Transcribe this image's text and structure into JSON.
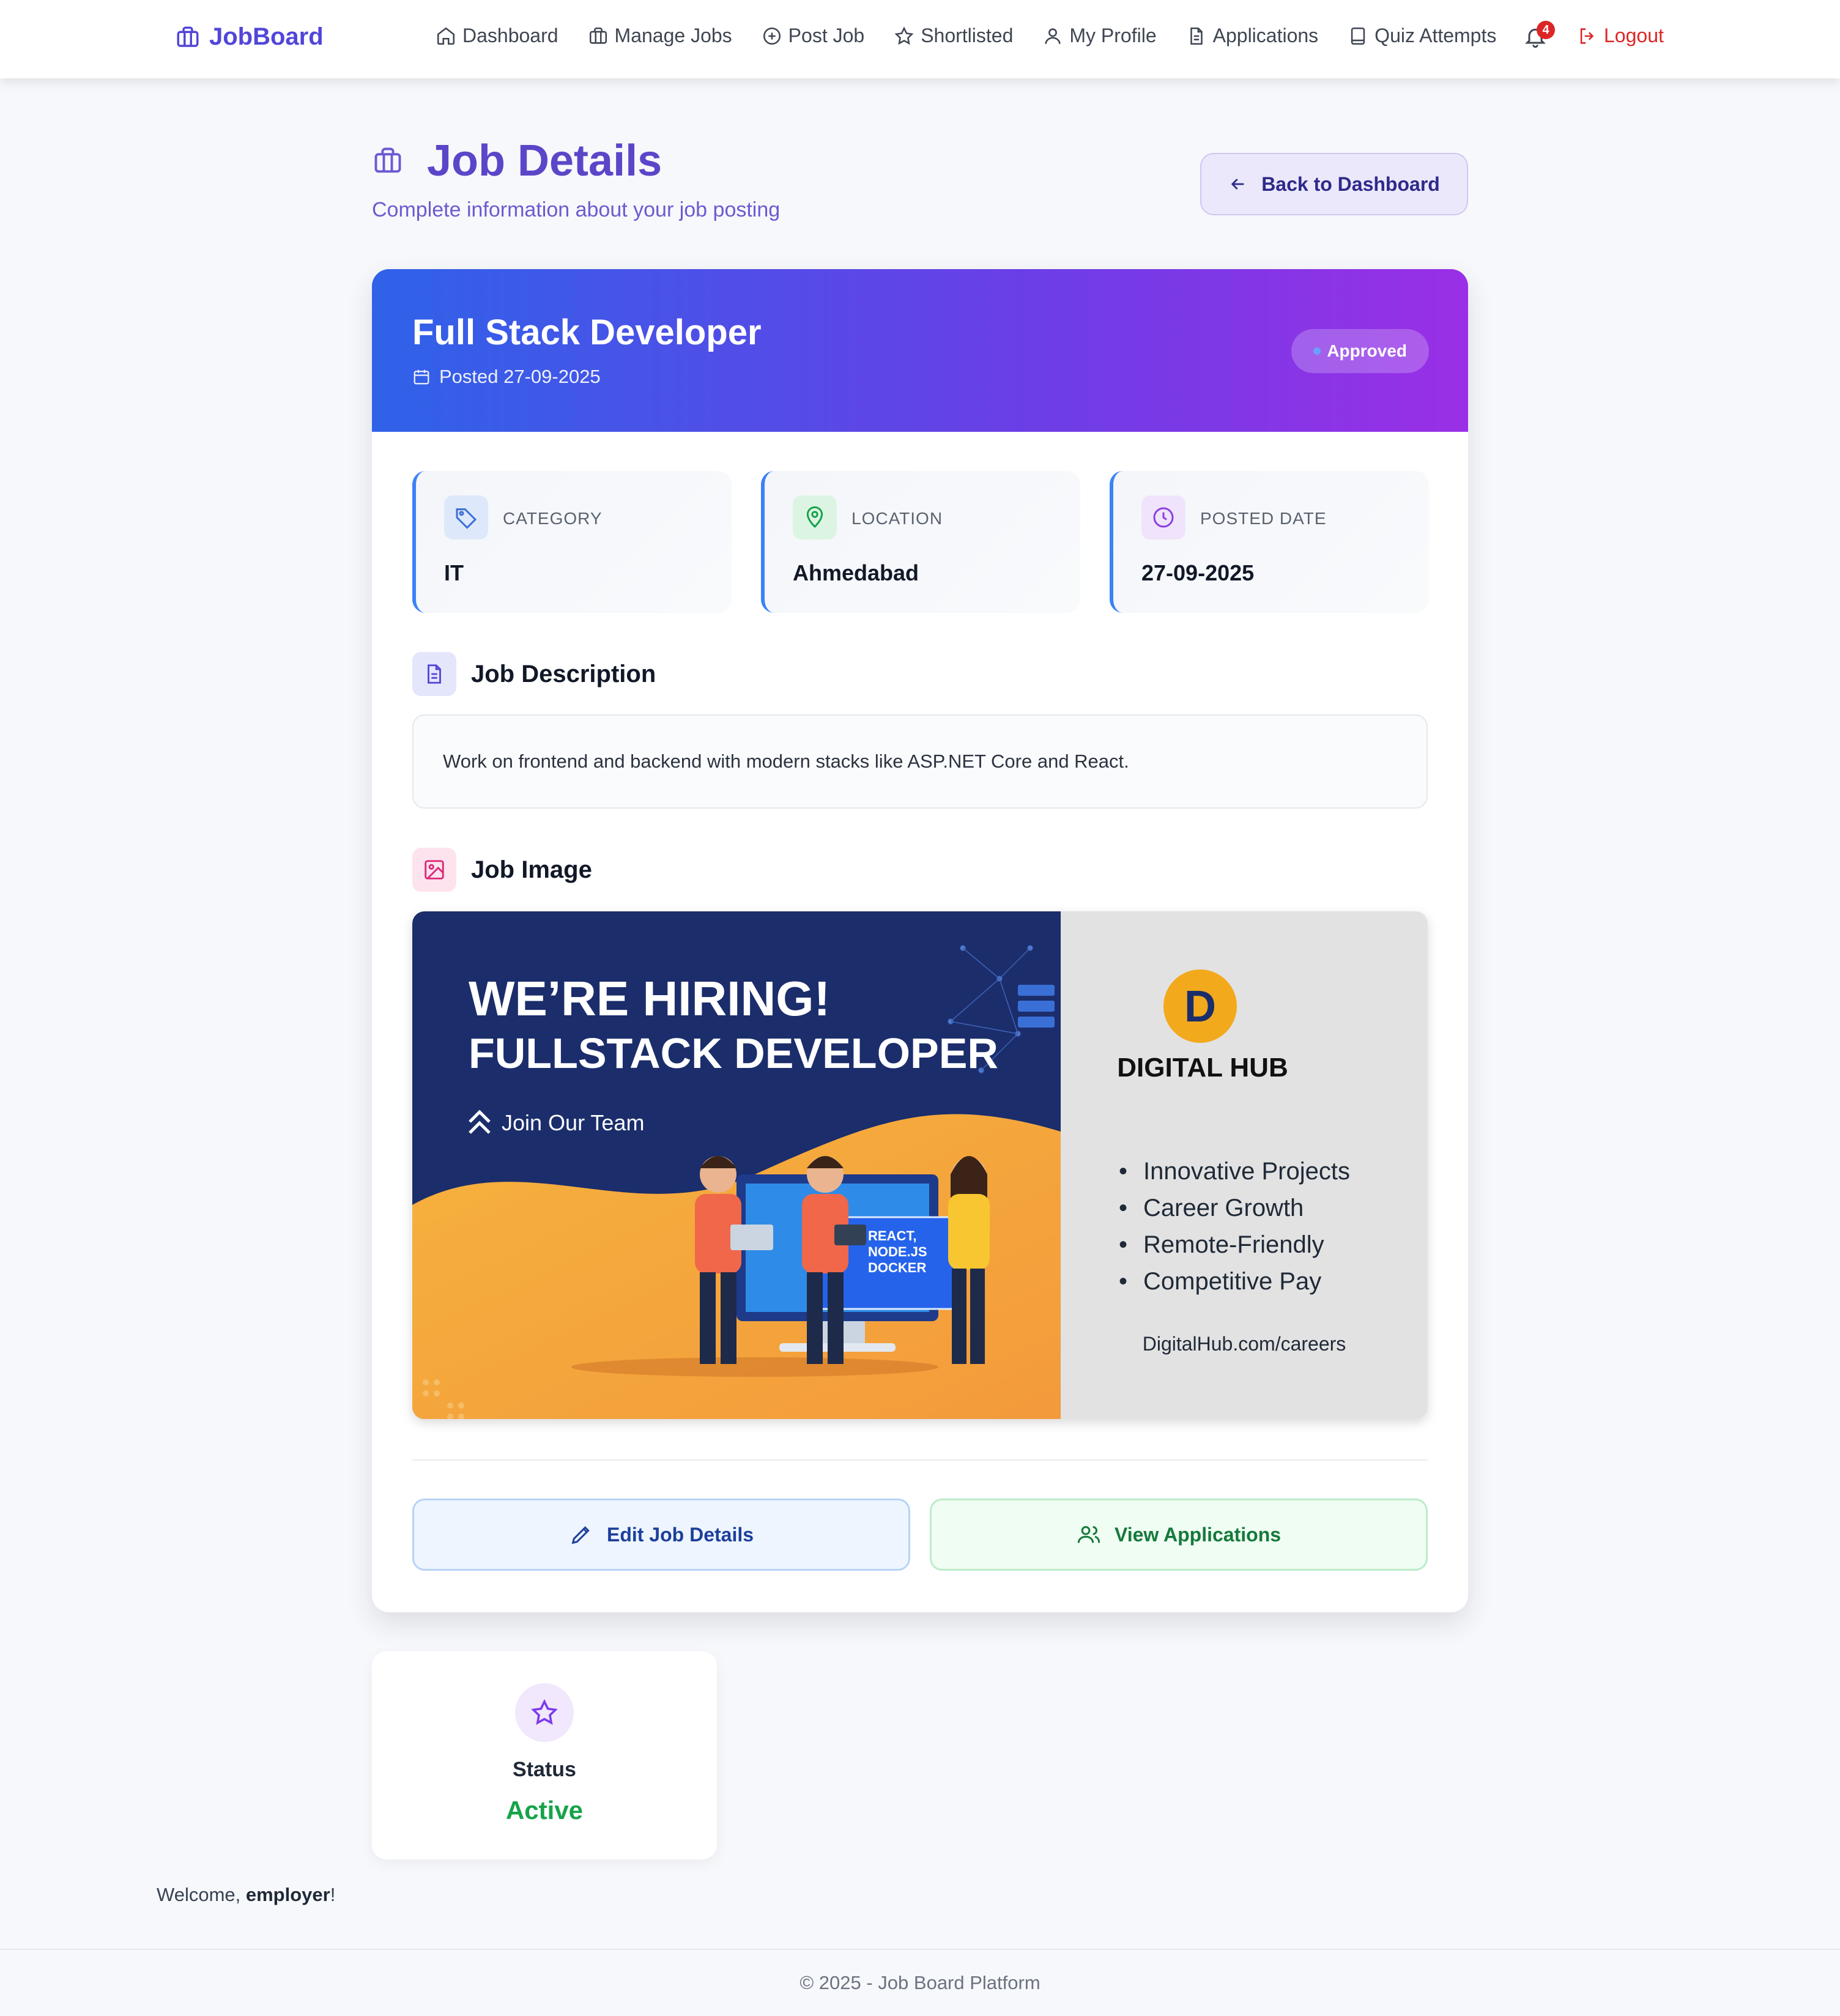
{
  "brand": {
    "name": "JobBoard"
  },
  "nav": {
    "items": [
      {
        "label": "Dashboard",
        "icon": "home-icon"
      },
      {
        "label": "Manage Jobs",
        "icon": "briefcase-icon"
      },
      {
        "label": "Post Job",
        "icon": "plus-circle-icon"
      },
      {
        "label": "Shortlisted",
        "icon": "star-icon"
      },
      {
        "label": "My Profile",
        "icon": "user-icon"
      },
      {
        "label": "Applications",
        "icon": "document-icon"
      },
      {
        "label": "Quiz Attempts",
        "icon": "book-icon"
      }
    ],
    "notifications_count": "4",
    "logout_label": "Logout"
  },
  "page": {
    "title": "Job Details",
    "subtitle": "Complete information about your job posting",
    "back_label": "Back to Dashboard"
  },
  "job": {
    "title": "Full Stack Developer",
    "posted_text": "Posted 27-09-2025",
    "status_badge": "Approved",
    "info": [
      {
        "label": "CATEGORY",
        "value": "IT",
        "icon": "tag-icon"
      },
      {
        "label": "LOCATION",
        "value": "Ahmedabad",
        "icon": "map-pin-icon"
      },
      {
        "label": "POSTED DATE",
        "value": "27-09-2025",
        "icon": "clock-icon"
      }
    ],
    "description_heading": "Job Description",
    "description": "Work on frontend and backend with modern stacks like ASP.NET Core and React.",
    "image_heading": "Job Image",
    "image": {
      "headline1": "WE’RE HIRING!",
      "headline2": "FULLSTACK DEVELOPER",
      "tagline": "Join Our Team",
      "screen_text": [
        "REACT,",
        "NODE.JS",
        "DOCKER"
      ],
      "company": "DIGITAL HUB",
      "logo_letter": "D",
      "bullets": [
        "Innovative Projects",
        "Career Growth",
        "Remote-Friendly",
        "Competitive Pay"
      ],
      "url": "DigitalHub.com/careers"
    }
  },
  "actions": {
    "edit_label": "Edit Job Details",
    "applications_label": "View Applications"
  },
  "status_card": {
    "label": "Status",
    "value": "Active"
  },
  "welcome": {
    "prefix": "Welcome, ",
    "user": "employer",
    "suffix": "!"
  },
  "footer": {
    "text": "© 2025 - Job Board Platform"
  },
  "colors": {
    "brand": "#5146d8",
    "accent_purple": "#7c3aed",
    "success": "#16a34a",
    "danger": "#dc2626",
    "header_gradient_start": "#2f62e8",
    "header_gradient_end": "#9a2fe6"
  }
}
